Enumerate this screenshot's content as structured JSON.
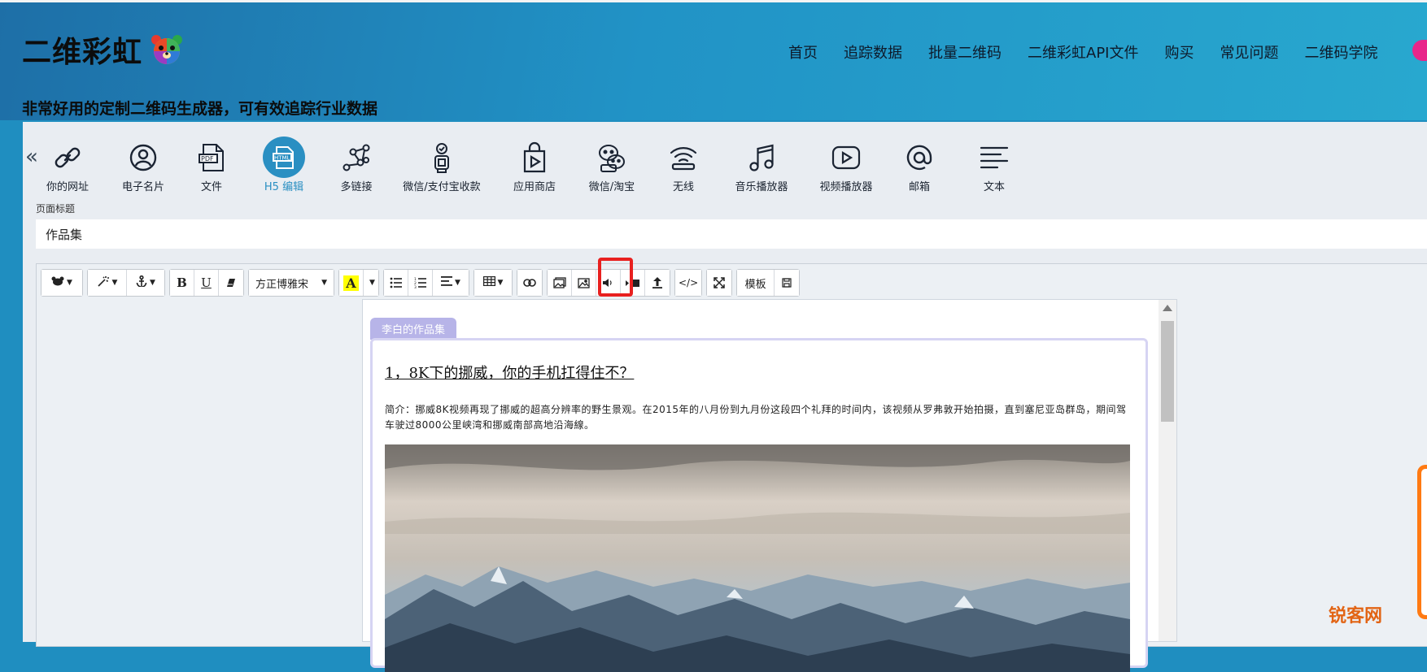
{
  "brand": {
    "name": "二维彩虹",
    "tagline": "非常好用的定制二维码生成器，可有效追踪行业数据"
  },
  "nav": [
    "首页",
    "追踪数据",
    "批量二维码",
    "二维彩虹API文件",
    "购买",
    "常见问题",
    "二维码学院"
  ],
  "tools": [
    {
      "label": "你的网址",
      "icon": "link-icon"
    },
    {
      "label": "电子名片",
      "icon": "contact-icon"
    },
    {
      "label": "文件",
      "icon": "pdf-file-icon"
    },
    {
      "label": "H5 编辑",
      "icon": "html-icon"
    },
    {
      "label": "多链接",
      "icon": "multi-link-icon"
    },
    {
      "label": "微信/支付宝收款",
      "icon": "payment-icon"
    },
    {
      "label": "应用商店",
      "icon": "app-store-icon"
    },
    {
      "label": "微信/淘宝",
      "icon": "wechat-icon"
    },
    {
      "label": "无线",
      "icon": "wifi-icon"
    },
    {
      "label": "音乐播放器",
      "icon": "music-icon"
    },
    {
      "label": "视频播放器",
      "icon": "video-icon"
    },
    {
      "label": "邮箱",
      "icon": "email-icon"
    },
    {
      "label": "文本",
      "icon": "text-icon"
    }
  ],
  "active_tool": "H5 编辑",
  "page_title": {
    "label": "页面标题",
    "value": "作品集"
  },
  "toolbar": {
    "font": "方正博雅宋",
    "template": "模板",
    "bold": "B",
    "underline": "U",
    "code": "</>",
    "color_letter": "A"
  },
  "article": {
    "tab": "李白的作品集",
    "title": "1，8K下的挪威，你的手机扛得住不？",
    "intro": "简介：挪威8K视频再现了挪威的超高分辨率的野生景观。在2015年的八月份到九月份这段四个礼拜的时间内，该视频从罗弗敦开始拍摄，直到塞尼亚岛群岛，期间驾车驶过8000公里峡湾和挪威南部高地沿海線。"
  },
  "watermark": "锐客网",
  "colors": {
    "accent": "#2a8fc2",
    "highlight": "#e8201f",
    "tab": "#b7b4e8"
  }
}
